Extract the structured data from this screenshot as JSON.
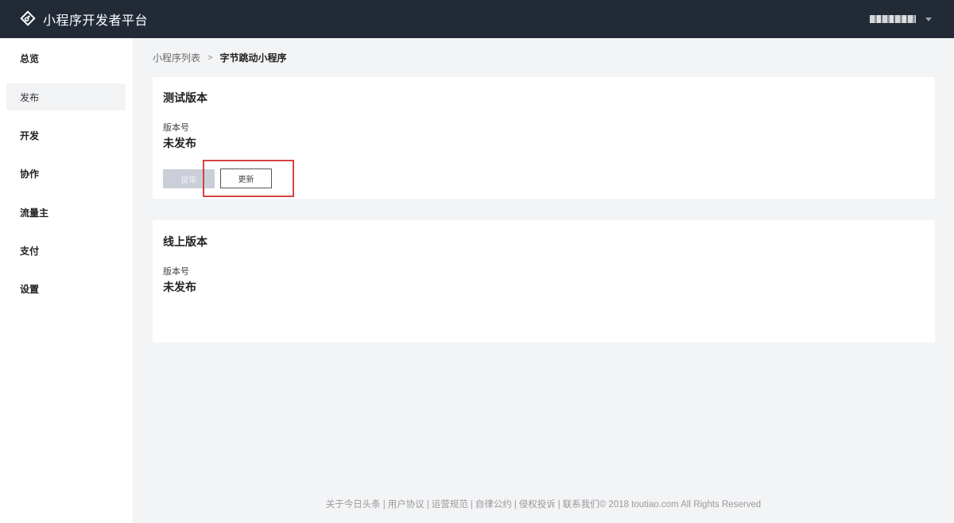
{
  "header": {
    "app_title": "小程序开发者平台",
    "logo_icon": "app-logo-icon",
    "user_menu_icon": "caret-down-icon"
  },
  "sidebar": {
    "items": [
      {
        "label": "总览",
        "active": false
      },
      {
        "label": "发布",
        "active": true
      },
      {
        "label": "开发",
        "active": false
      },
      {
        "label": "协作",
        "active": false
      },
      {
        "label": "流量主",
        "active": false
      },
      {
        "label": "支付",
        "active": false
      },
      {
        "label": "设置",
        "active": false
      }
    ]
  },
  "breadcrumb": {
    "parent": "小程序列表",
    "separator": ">",
    "current": "字节跳动小程序"
  },
  "test_version": {
    "title": "测试版本",
    "version_label": "版本号",
    "version_value": "未发布",
    "submit_label": "提审",
    "update_label": "更新"
  },
  "online_version": {
    "title": "线上版本",
    "version_label": "版本号",
    "version_value": "未发布"
  },
  "footer": {
    "links": [
      "关于今日头条",
      "用户协议",
      "运营规范",
      "自律公约",
      "侵权投诉",
      "联系我们"
    ],
    "separator": "|",
    "copyright": "© 2018 toutiao.com All Rights Reserved"
  },
  "colors": {
    "topbar": "#222a36",
    "background": "#f3f4f6",
    "highlight": "#d64242",
    "disabled_button": "#c9ced9"
  }
}
